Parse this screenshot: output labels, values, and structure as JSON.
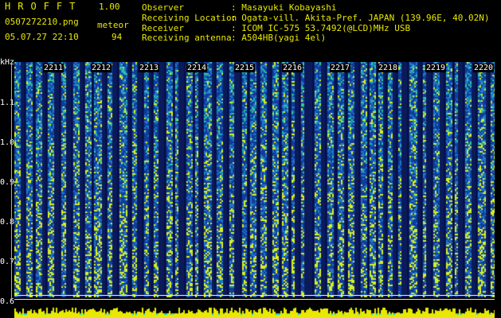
{
  "header": {
    "app_title": "HROFFT",
    "version": "1.00",
    "filename": "0507272210.png",
    "mode": "meteor",
    "datetime": "05.07.27 22:10",
    "count": "94"
  },
  "info": {
    "observer_label": "Observer",
    "observer_value": ": Masayuki Kobayashi",
    "location_label": "Receiving Location",
    "location_value": ": Ogata-vill. Akita-Pref. JAPAN (139.96E, 40.02N)",
    "receiver_label": "Receiver",
    "receiver_value": ": ICOM IC-575 53.7492(@LCD)MHz USB",
    "antenna_label": "Receiving antenna",
    "antenna_value": ": A504HB(yagi 4el)"
  },
  "spectrogram": {
    "unit": "kHz",
    "yticks": [
      "1.1",
      "1.0",
      "0.9",
      "0.8",
      "0.7",
      "0.6"
    ],
    "time_ticks": [
      "2211",
      "2212",
      "2213",
      "2214",
      "2215",
      "2216",
      "2217",
      "2218",
      "2219",
      "2220"
    ],
    "colors": {
      "background": "#000000",
      "text": "#e8e800",
      "power": "#e8e800",
      "power_base": "#00e8e8"
    }
  }
}
